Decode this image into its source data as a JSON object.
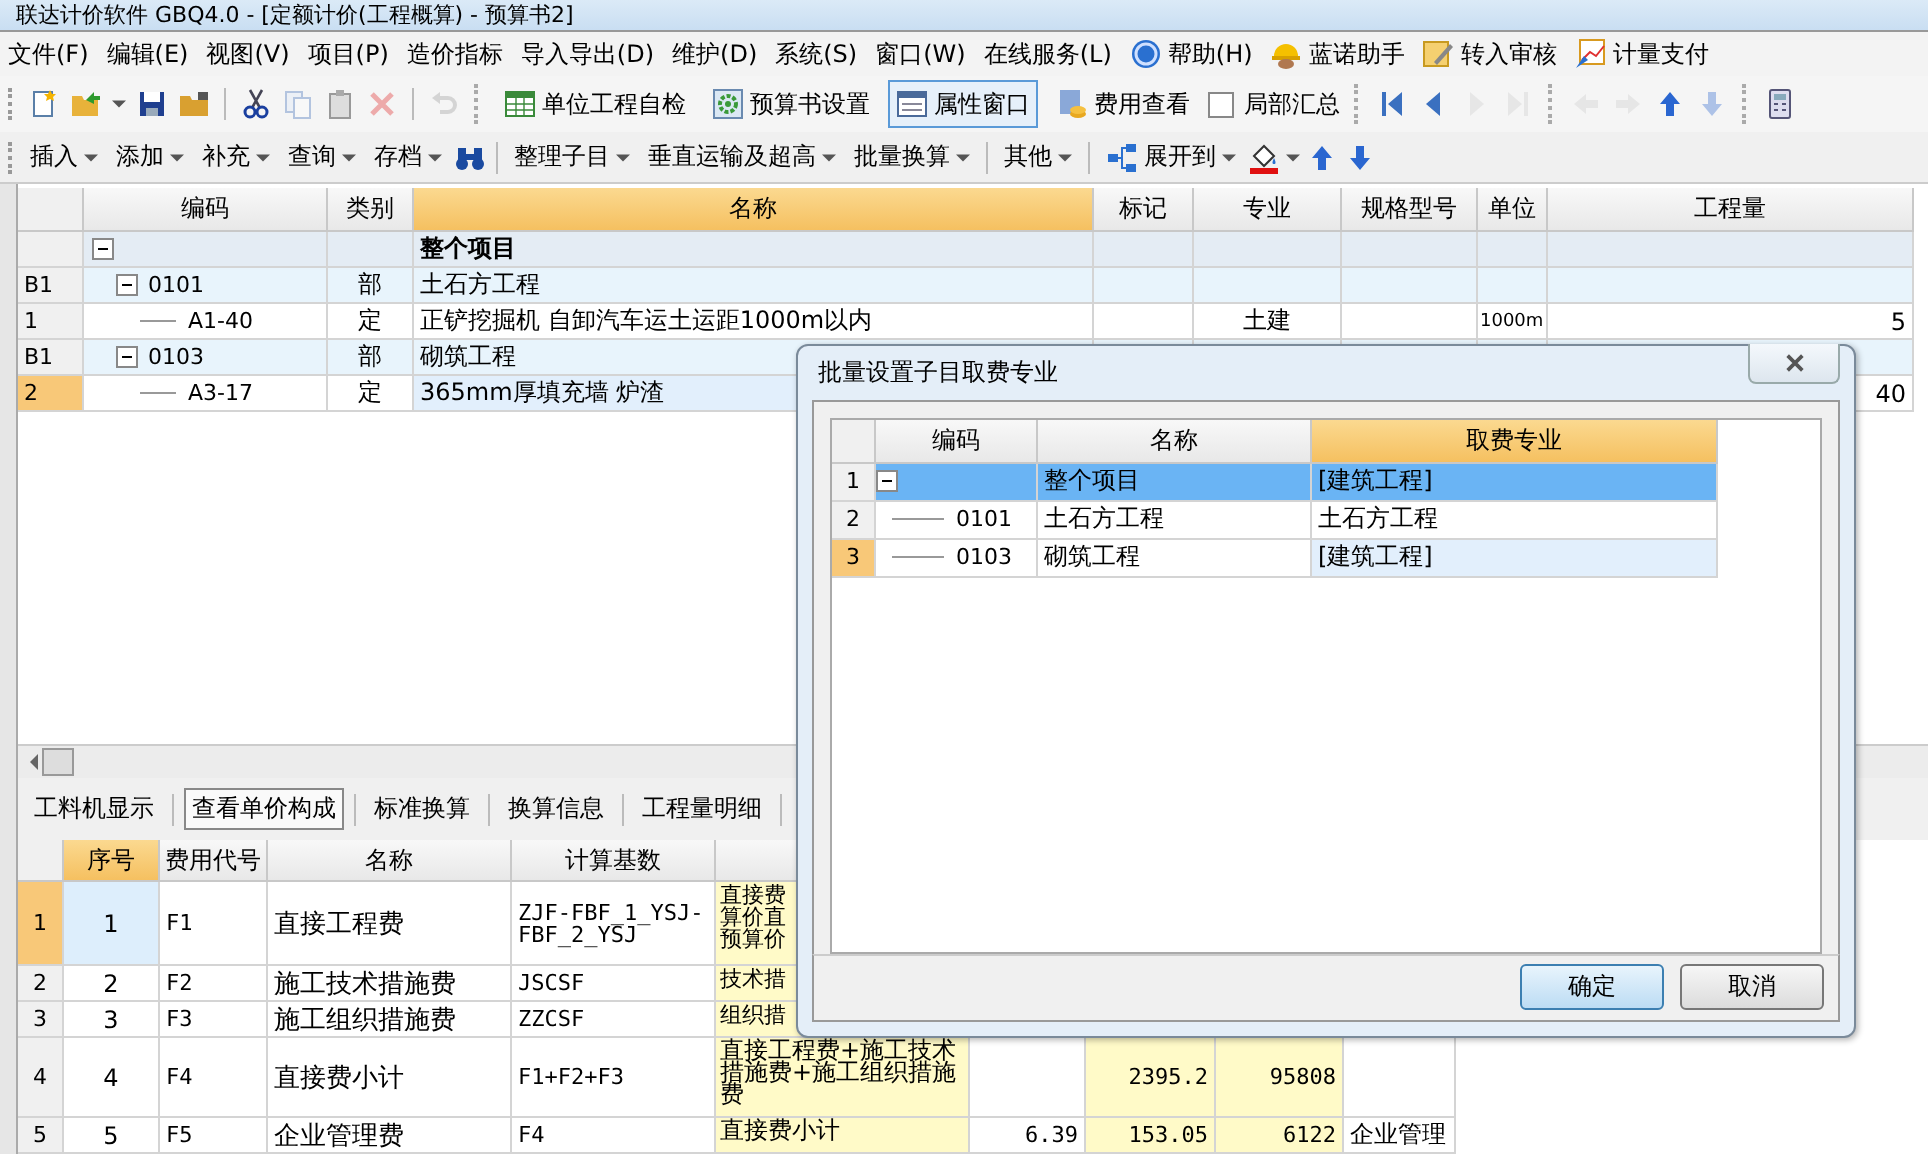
{
  "window": {
    "title": "联达计价软件 GBQ4.0 - [定额计价(工程概算) - 预算书2]"
  },
  "menu": [
    {
      "label": "文件(F)",
      "kind": "text"
    },
    {
      "label": "编辑(E)",
      "kind": "text"
    },
    {
      "label": "视图(V)",
      "kind": "text"
    },
    {
      "label": "项目(P)",
      "kind": "text"
    },
    {
      "label": "造价指标",
      "kind": "text"
    },
    {
      "label": "导入导出(D)",
      "kind": "text"
    },
    {
      "label": "维护(D)",
      "kind": "text"
    },
    {
      "label": "系统(S)",
      "kind": "text"
    },
    {
      "label": "窗口(W)",
      "kind": "text"
    },
    {
      "label": "在线服务(L)",
      "kind": "text"
    },
    {
      "label": "帮助(H)",
      "kind": "help"
    },
    {
      "label": "蓝诺助手",
      "kind": "assistant"
    },
    {
      "label": "转入审核",
      "kind": "review"
    },
    {
      "label": "计量支付",
      "kind": "payment"
    }
  ],
  "toolbar": {
    "icons": [
      {
        "disabled": false
      },
      {
        "disabled": false
      },
      {
        "disabled": false
      },
      {
        "disabled": false
      },
      {
        "disabled": false
      },
      {
        "disabled": false
      },
      {
        "disabled": true
      },
      {
        "disabled": false
      },
      {
        "disabled": true
      },
      {
        "disabled": true
      }
    ],
    "buttons": [
      {
        "label": "单位工程自检",
        "selected": false
      },
      {
        "label": "预算书设置",
        "selected": false
      },
      {
        "label": "属性窗口",
        "selected": true
      },
      {
        "label": "费用查看",
        "selected": false
      }
    ],
    "checkbox": {
      "label": "局部汇总",
      "checked": false
    },
    "nav": [
      {
        "disabled": false
      },
      {
        "disabled": false
      },
      {
        "disabled": true
      },
      {
        "disabled": true
      },
      {
        "disabled": true
      },
      {
        "disabled": true
      },
      {
        "disabled": false
      },
      {
        "disabled": true
      }
    ]
  },
  "edit_toolbar": [
    {
      "kind": "menu",
      "label": "插入"
    },
    {
      "kind": "menu",
      "label": "添加"
    },
    {
      "kind": "menu",
      "label": "补充"
    },
    {
      "kind": "menu",
      "label": "查询"
    },
    {
      "kind": "menu",
      "label": "存档"
    },
    {
      "kind": "find"
    },
    {
      "kind": "menu",
      "label": "整理子目"
    },
    {
      "kind": "menu",
      "label": "垂直运输及超高"
    },
    {
      "kind": "menu",
      "label": "批量换算"
    },
    {
      "kind": "menu",
      "label": "其他"
    },
    {
      "kind": "expand",
      "label": "展开到"
    },
    {
      "kind": "fill"
    },
    {
      "kind": "up"
    },
    {
      "kind": "down"
    }
  ],
  "table": {
    "columns": [
      {
        "label": "编码",
        "selected": false
      },
      {
        "label": "类别",
        "selected": false
      },
      {
        "label": "名称",
        "selected": true
      },
      {
        "label": "标记",
        "selected": false
      },
      {
        "label": "专业",
        "selected": false
      },
      {
        "label": "规格型号",
        "selected": false
      },
      {
        "label": "单位",
        "selected": false
      },
      {
        "label": "工程量",
        "selected": false
      }
    ],
    "rows": [
      {
        "kind": "project",
        "name": "整个项目",
        "expanded": true,
        "selected": false,
        "children": [
          {
            "kind": "section",
            "num": "B1",
            "code": "0101",
            "category": "部",
            "name": "土石方工程",
            "expanded": true,
            "selected": false,
            "children": [
              {
                "kind": "item",
                "num": "1",
                "code": "A1-40",
                "category": "定",
                "name": "正铲挖掘机 自卸汽车运土运距1000m以内",
                "specialty": "土建",
                "unit": "1000m",
                "quantity": "5",
                "selected": false
              }
            ]
          },
          {
            "kind": "section",
            "num": "B1",
            "code": "0103",
            "category": "部",
            "name": "砌筑工程",
            "expanded": true,
            "selected": false,
            "children": [
              {
                "kind": "item",
                "num": "2",
                "code": "A3-17",
                "category": "定",
                "name": "365mm厚填充墙 炉渣",
                "quantity": "40",
                "selected": true
              }
            ]
          }
        ]
      }
    ]
  },
  "cost_tabs": [
    {
      "label": "工料机显示",
      "selected": false
    },
    {
      "label": "查看单价构成",
      "selected": true
    },
    {
      "label": "标准换算",
      "selected": false
    },
    {
      "label": "换算信息",
      "selected": false
    },
    {
      "label": "工程量明细",
      "selected": false
    }
  ],
  "cost_table": {
    "columns": [
      {
        "label": "序号",
        "selected": true
      },
      {
        "label": "费用代号",
        "selected": false
      },
      {
        "label": "名称",
        "selected": false
      },
      {
        "label": "计算基数",
        "selected": false
      }
    ],
    "rows": [
      {
        "kind": "covered",
        "num": "1",
        "seq": "1",
        "code": "F1",
        "name": "直接工程费",
        "base": "ZJF-FBF_1_YSJ-FBF_2_YSJ",
        "column_5": "直接费算价直预算价",
        "selected": true
      },
      {
        "kind": "covered",
        "num": "2",
        "seq": "2",
        "code": "F2",
        "name": "施工技术措施费",
        "base": "JSCSF",
        "column_5": "技术措",
        "selected": false
      },
      {
        "kind": "covered",
        "num": "3",
        "seq": "3",
        "code": "F3",
        "name": "施工组织措施费",
        "base": "ZZCSF",
        "column_5": "组织措",
        "selected": false
      },
      {
        "kind": "full",
        "num": "4",
        "seq": "4",
        "code": "F4",
        "name": "直接费小计",
        "base": "F1+F2+F3",
        "column_5": "直接工程费+施工技术措施费+施工组织措施费",
        "column_7": "2395.2",
        "column_8": "95808",
        "selected": false
      },
      {
        "kind": "full",
        "num": "5",
        "seq": "5",
        "code": "F5",
        "name": "企业管理费",
        "base": "F4",
        "column_5": "直接费小计",
        "column_6": "6.39",
        "column_7": "153.05",
        "column_8": "6122",
        "column_9": "企业管理",
        "selected": false
      }
    ]
  },
  "dialog": {
    "title": "批量设置子目取费专业",
    "columns": [
      {
        "label": "编码",
        "selected": false
      },
      {
        "label": "名称",
        "selected": false
      },
      {
        "label": "取费专业",
        "selected": true
      }
    ],
    "rows": [
      {
        "num": "1",
        "name": "整个项目",
        "fee": "[建筑工程]",
        "expanded": true,
        "selected": true,
        "current": false,
        "children": [
          {
            "num": "2",
            "code": "0101",
            "name": "土石方工程",
            "fee": "土石方工程",
            "selected": false,
            "current": false
          },
          {
            "num": "3",
            "code": "0103",
            "name": "砌筑工程",
            "fee": "[建筑工程]",
            "selected": false,
            "current": true
          }
        ]
      }
    ],
    "buttons": [
      {
        "label": "确定",
        "default": true
      },
      {
        "label": "取消",
        "default": false
      }
    ]
  }
}
